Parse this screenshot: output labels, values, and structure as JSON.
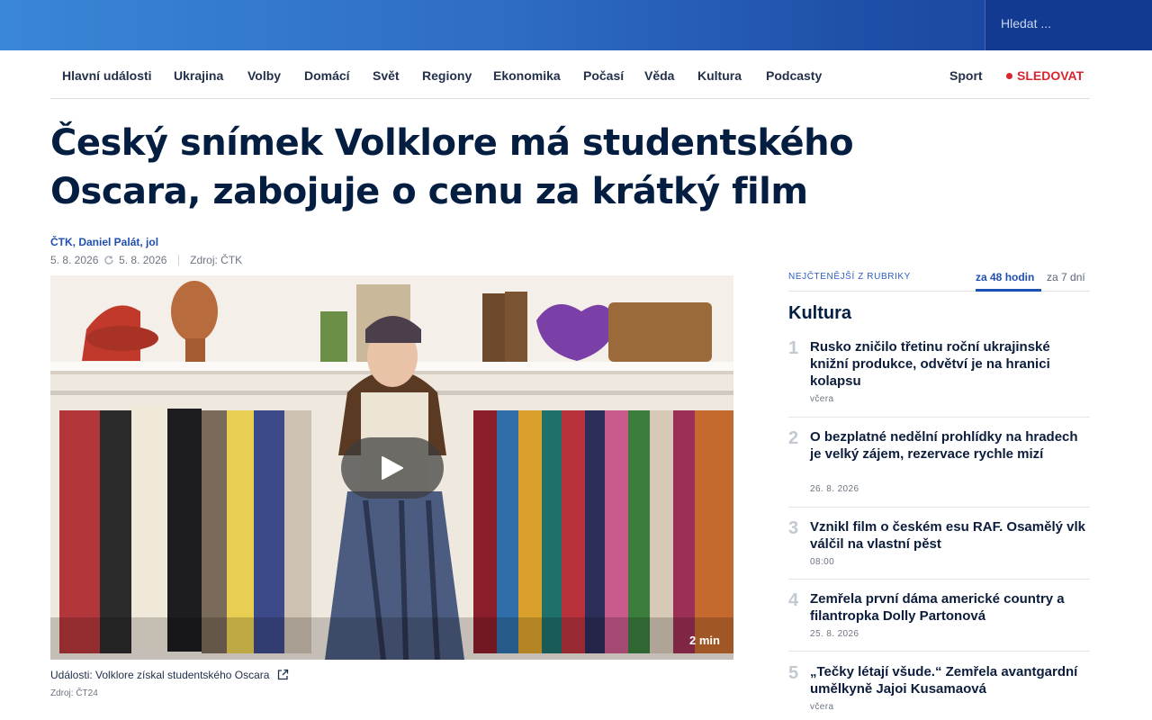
{
  "search": {
    "placeholder": "Hledat ..."
  },
  "nav": {
    "items": [
      "Hlavní události",
      "Ukrajina",
      "Volby",
      "Domácí",
      "Svět",
      "Regiony",
      "Ekonomika",
      "Počasí",
      "Věda",
      "Kultura",
      "Podcasty"
    ],
    "sport": "Sport",
    "follow": "SLEDOVAT"
  },
  "article": {
    "title_line1": "Český snímek Volklore má studentského",
    "title_line2": "Oscara, zabojuje o cenu za krátký film",
    "authors": "ČTK, Daniel Palát, jol",
    "published": "5. 8. 2026",
    "updated": "5. 8. 2026",
    "source": "Zdroj: ČTK"
  },
  "video": {
    "duration": "2 min",
    "caption": "Události: Volklore získal studentského Oscara",
    "source": "Zdroj: ČT24"
  },
  "sidebar": {
    "label": "NEJČTENĚJŠÍ Z RUBRIKY",
    "tab_active": "za 48 hodin",
    "tab_inactive": "za 7 dní",
    "section": "Kultura",
    "items": [
      {
        "num": "1",
        "title": "Rusko zničilo třetinu roční ukrajinské knižní produkce, odvětví je na hranici kolapsu",
        "time": "včera"
      },
      {
        "num": "2",
        "title": "O bezplatné nedělní prohlídky na hradech je velký zájem, rezervace rychle mizí",
        "time": "26. 8. 2026"
      },
      {
        "num": "3",
        "title": "Vznikl film o českém esu RAF. Osamělý vlk válčil na vlastní pěst",
        "time": "08:00"
      },
      {
        "num": "4",
        "title": "Zemřela první dáma americké country a filantropka Dolly Partonová",
        "time": "25. 8. 2026"
      },
      {
        "num": "5",
        "title": "„Tečky létají všude.“ Zemřela avantgardní umělkyně Jajoi Kusamaová",
        "time": "včera"
      }
    ]
  },
  "colors": {
    "brand_blue": "#1f4fb0",
    "follow_red": "#d7262f",
    "title_navy": "#041e42"
  }
}
